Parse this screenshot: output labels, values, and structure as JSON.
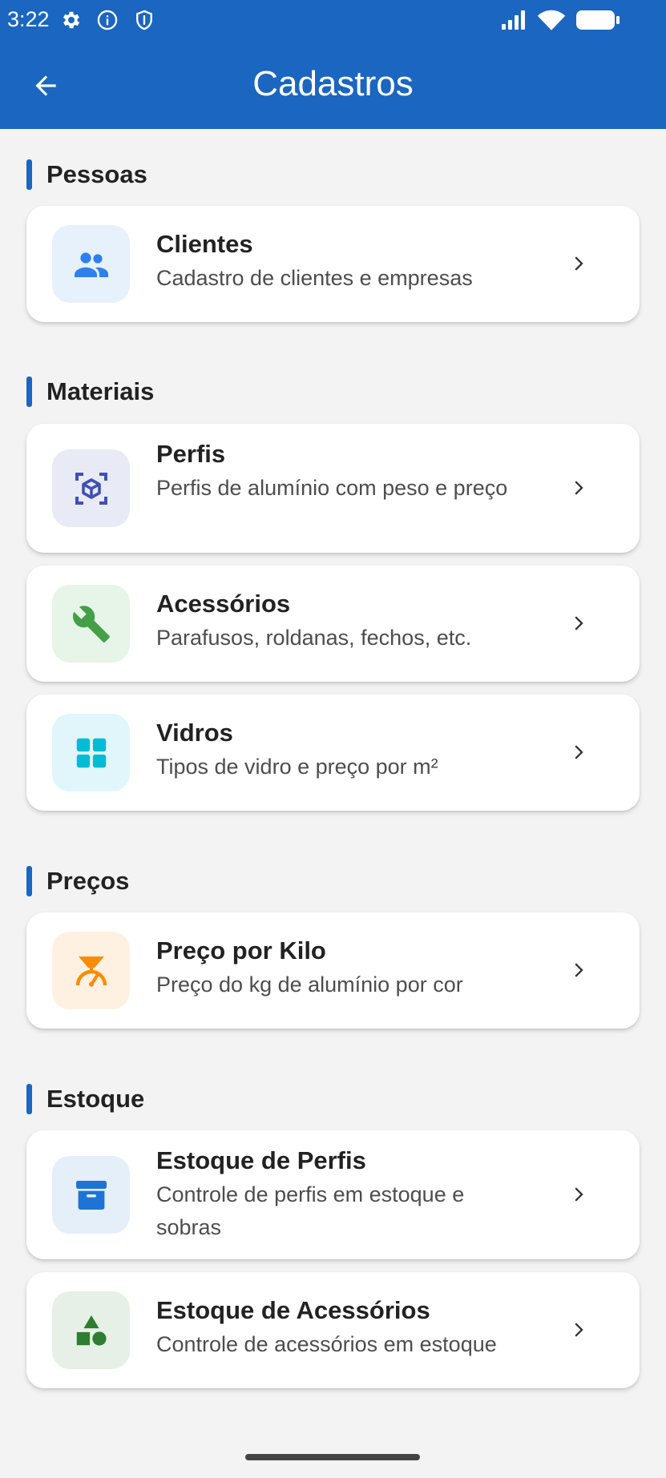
{
  "status_bar": {
    "time": "3:22",
    "icons": [
      "settings-gear-icon",
      "info-icon",
      "shield-icon",
      "signal-icon",
      "wifi-icon",
      "battery-icon"
    ]
  },
  "app_bar": {
    "title": "Cadastros",
    "back_icon": "arrow-back-icon",
    "background_color": "#1a66c0"
  },
  "sections": [
    {
      "label": "Pessoas",
      "items": [
        {
          "title": "Clientes",
          "subtitle": "Cadastro de clientes e empresas",
          "icon": "people-icon",
          "icon_color": "#2f80ed",
          "icon_bg": "#e6f1fc"
        }
      ]
    },
    {
      "label": "Materiais",
      "items": [
        {
          "title": "Perfis",
          "subtitle": "Perfis de alumínio com peso e preço",
          "icon": "view-in-ar-cube-icon",
          "icon_color": "#3f51b5",
          "icon_bg": "#e8eaf6"
        },
        {
          "title": "Acessórios",
          "subtitle": "Parafusos, roldanas, fechos, etc.",
          "icon": "wrench-icon",
          "icon_color": "#43a047",
          "icon_bg": "#e7f4e8"
        },
        {
          "title": "Vidros",
          "subtitle": "Tipos de vidro e preço por m²",
          "icon": "window-icon",
          "icon_color": "#00bcd4",
          "icon_bg": "#e0f6fa"
        }
      ]
    },
    {
      "label": "Preços",
      "items": [
        {
          "title": "Preço por Kilo",
          "subtitle": "Preço do kg de alumínio por cor",
          "icon": "scale-icon",
          "icon_color": "#fb8c00",
          "icon_bg": "#fff1e2"
        }
      ]
    },
    {
      "label": "Estoque",
      "items": [
        {
          "title": "Estoque de Perfis",
          "subtitle": "Controle de perfis em estoque e sobras",
          "icon": "inventory-box-icon",
          "icon_color": "#1e73d6",
          "icon_bg": "#e5effa"
        },
        {
          "title": "Estoque de Acessórios",
          "subtitle": "Controle de acessórios em estoque",
          "icon": "category-shapes-icon",
          "icon_color": "#2e7d32",
          "icon_bg": "#e6f0e7"
        }
      ]
    }
  ]
}
